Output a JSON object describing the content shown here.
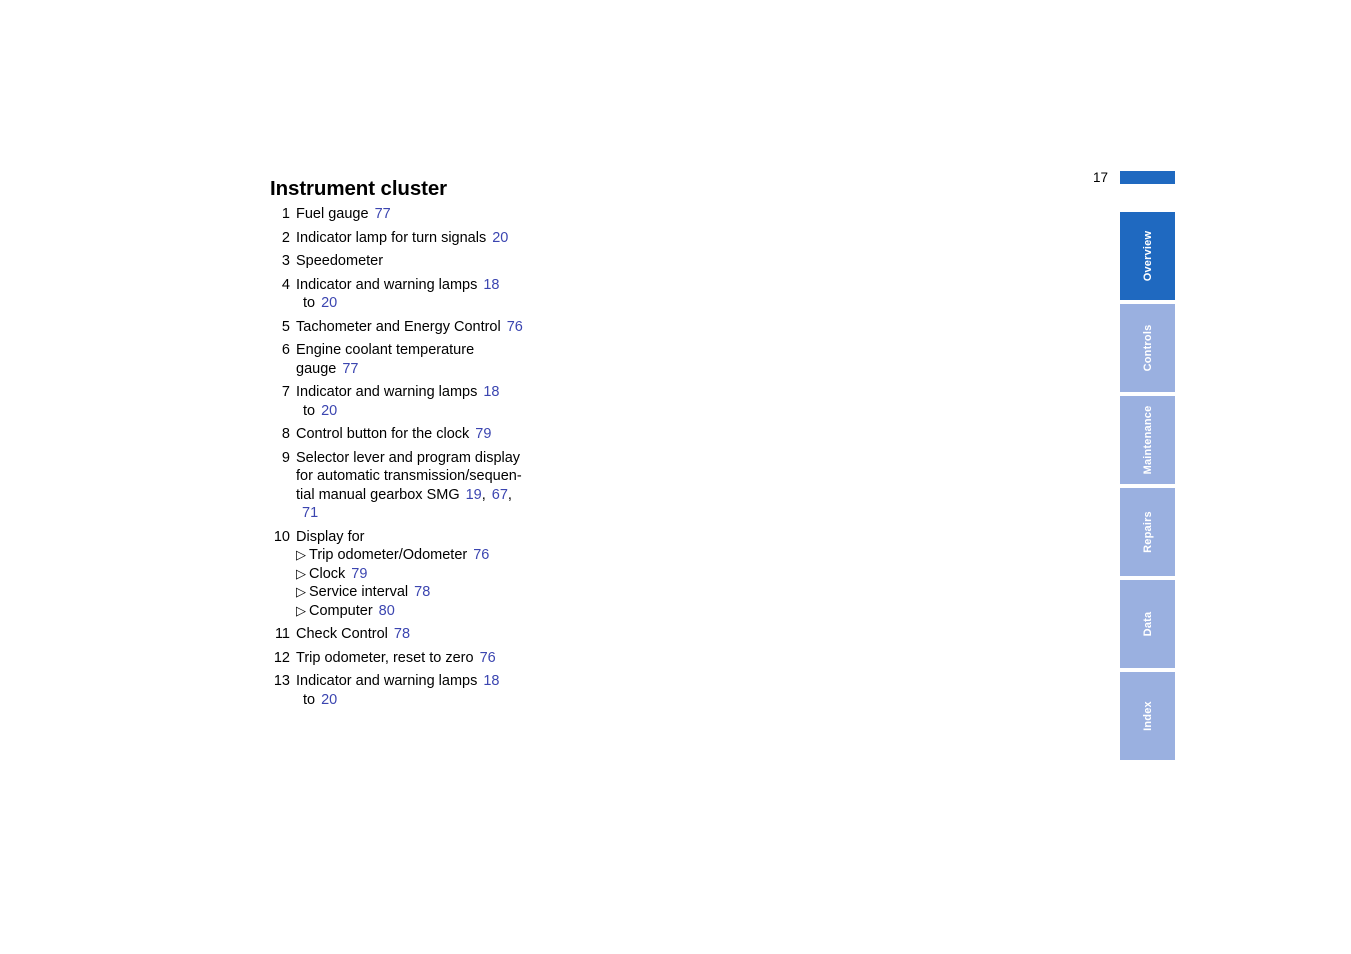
{
  "document": {
    "title": "Instrument cluster",
    "page_number": "17"
  },
  "list": {
    "items": [
      {
        "number": "1",
        "lines": [
          {
            "text": "Fuel gauge",
            "refs": [
              "77"
            ]
          }
        ]
      },
      {
        "number": "2",
        "lines": [
          {
            "text": "Indicator lamp for turn signals",
            "refs": [
              "20"
            ]
          }
        ]
      },
      {
        "number": "3",
        "lines": [
          {
            "text": "Speedometer",
            "refs": []
          }
        ]
      },
      {
        "number": "4",
        "lines": [
          {
            "text": "Indicator and warning lamps",
            "refs": [
              "18"
            ]
          },
          {
            "text": "to",
            "refs": [
              "20"
            ]
          }
        ]
      },
      {
        "number": "5",
        "lines": [
          {
            "text": "Tachometer and Energy Control",
            "refs": [
              "76"
            ]
          }
        ]
      },
      {
        "number": "6",
        "lines": [
          {
            "text": "Engine coolant temperature",
            "refs": []
          },
          {
            "text": "gauge",
            "refs": [
              "77"
            ]
          }
        ]
      },
      {
        "number": "7",
        "lines": [
          {
            "text": "Indicator and warning lamps",
            "refs": [
              "18"
            ]
          },
          {
            "text": "to",
            "refs": [
              "20"
            ]
          }
        ]
      },
      {
        "number": "8",
        "lines": [
          {
            "text": "Control button for the clock",
            "refs": [
              "79"
            ]
          }
        ]
      },
      {
        "number": "9",
        "lines": [
          {
            "text": "Selector lever and program display",
            "refs": []
          },
          {
            "text": "for automatic transmission/sequen-",
            "refs": []
          },
          {
            "text": "tial manual gearbox SMG",
            "refs": [
              "19",
              "67"
            ]
          },
          {
            "text": "",
            "refs": [
              "71"
            ]
          }
        ]
      },
      {
        "number": "10",
        "lines": [
          {
            "text": "Display for",
            "refs": []
          }
        ],
        "sublist": [
          {
            "bullet": "triangle-right-bullet",
            "text": "Trip odometer/Odometer",
            "refs": [
              "76"
            ]
          },
          {
            "bullet": "triangle-right-bullet",
            "text": "Clock",
            "refs": [
              "79"
            ]
          },
          {
            "bullet": "triangle-right-bullet",
            "text": "Service interval",
            "refs": [
              "78"
            ]
          },
          {
            "bullet": "triangle-right-bullet",
            "text": "Computer",
            "refs": [
              "80"
            ]
          }
        ]
      },
      {
        "number": "11",
        "lines": [
          {
            "text": "Check Control",
            "refs": [
              "78"
            ]
          }
        ]
      },
      {
        "number": "12",
        "lines": [
          {
            "text": "Trip odometer, reset to zero",
            "refs": [
              "76"
            ]
          }
        ]
      },
      {
        "number": "13",
        "lines": [
          {
            "text": "Indicator and warning lamps",
            "refs": [
              "18"
            ]
          },
          {
            "text": "to",
            "refs": [
              "20"
            ]
          }
        ]
      }
    ]
  },
  "side_tabs": {
    "items": [
      {
        "label": "Overview",
        "active": true
      },
      {
        "label": "Controls",
        "active": false
      },
      {
        "label": "Maintenance",
        "active": false
      },
      {
        "label": "Repairs",
        "active": false
      },
      {
        "label": "Data",
        "active": false
      },
      {
        "label": "Index",
        "active": false
      }
    ]
  },
  "colors": {
    "accent_blue": "#1F69C0",
    "tab_light_blue": "#9AB0E0",
    "reference_link": "#3B45B0",
    "text": "#000000",
    "background": "#FFFFFF"
  },
  "bullets": {
    "triangle-right-bullet": "▷"
  }
}
